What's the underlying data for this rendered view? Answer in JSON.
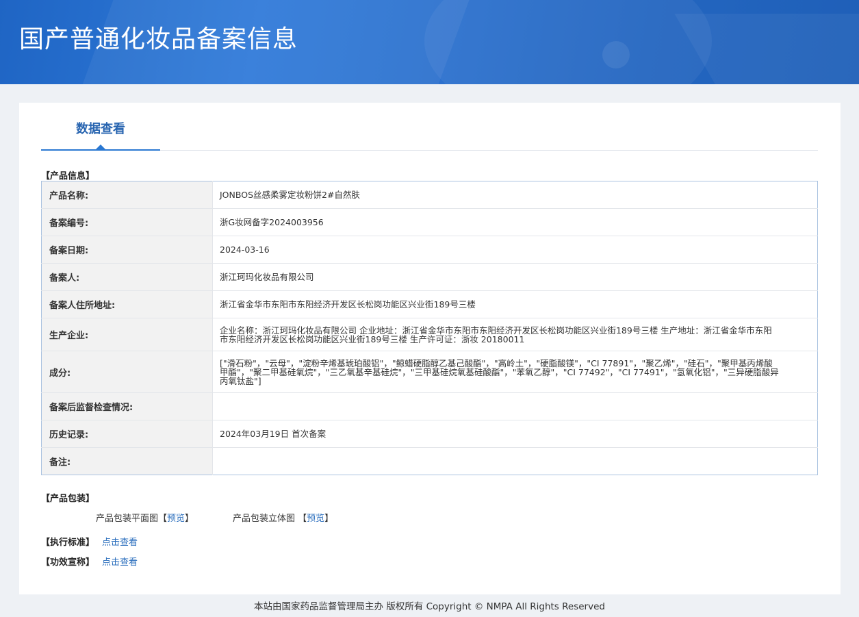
{
  "header": {
    "title": "国产普通化妆品备案信息"
  },
  "tab": {
    "label": "数据查看"
  },
  "sections": {
    "product_info": "【产品信息】",
    "packaging": "【产品包装】",
    "standard": "【执行标准】",
    "efficacy": "【功效宣称】"
  },
  "info_rows": [
    {
      "label": "产品名称:",
      "value": "JONBOS丝感柔雾定妆粉饼2#自然肤"
    },
    {
      "label": "备案编号:",
      "value": "浙G妆网备字2024003956"
    },
    {
      "label": "备案日期:",
      "value": "2024-03-16"
    },
    {
      "label": "备案人:",
      "value": "浙江珂玛化妆品有限公司"
    },
    {
      "label": "备案人住所地址:",
      "value": "浙江省金华市东阳市东阳经济开发区长松岗功能区兴业街189号三楼"
    },
    {
      "label": "生产企业:",
      "value": "企业名称：浙江珂玛化妆品有限公司 企业地址：浙江省金华市东阳市东阳经济开发区长松岗功能区兴业街189号三楼 生产地址：浙江省金华市东阳市东阳经济开发区长松岗功能区兴业街189号三楼 生产许可证：浙妆 20180011"
    },
    {
      "label": "成分:",
      "value": "[\"滑石粉\"，\"云母\"，\"淀粉辛烯基琥珀酸铝\"，\"鲸蜡硬脂醇乙基己酸酯\"，\"高岭土\"，\"硬脂酸镁\"，\"CI 77891\"，\"聚乙烯\"，\"硅石\"，\"聚甲基丙烯酸甲酯\"，\"聚二甲基硅氧烷\"，\"三乙氧基辛基硅烷\"，\"三甲基硅烷氧基硅酸酯\"，\"苯氧乙醇\"，\"CI 77492\"，\"CI 77491\"，\"氢氧化铝\"，\"三异硬脂酸异丙氧钛盐\"]"
    },
    {
      "label": "备案后监督检查情况:",
      "value": ""
    },
    {
      "label": "历史记录:",
      "value": "2024年03月19日 首次备案"
    },
    {
      "label": "备注:",
      "value": ""
    }
  ],
  "packaging": {
    "flat_label": "产品包装平面图",
    "flat_link": "预览",
    "solid_label": "产品包装立体图",
    "solid_link": "预览"
  },
  "links": {
    "standard": "点击查看",
    "efficacy": "点击查看"
  },
  "footer": {
    "text": "本站由国家药品监督管理局主办 版权所有 Copyright © NMPA All Rights Reserved"
  }
}
